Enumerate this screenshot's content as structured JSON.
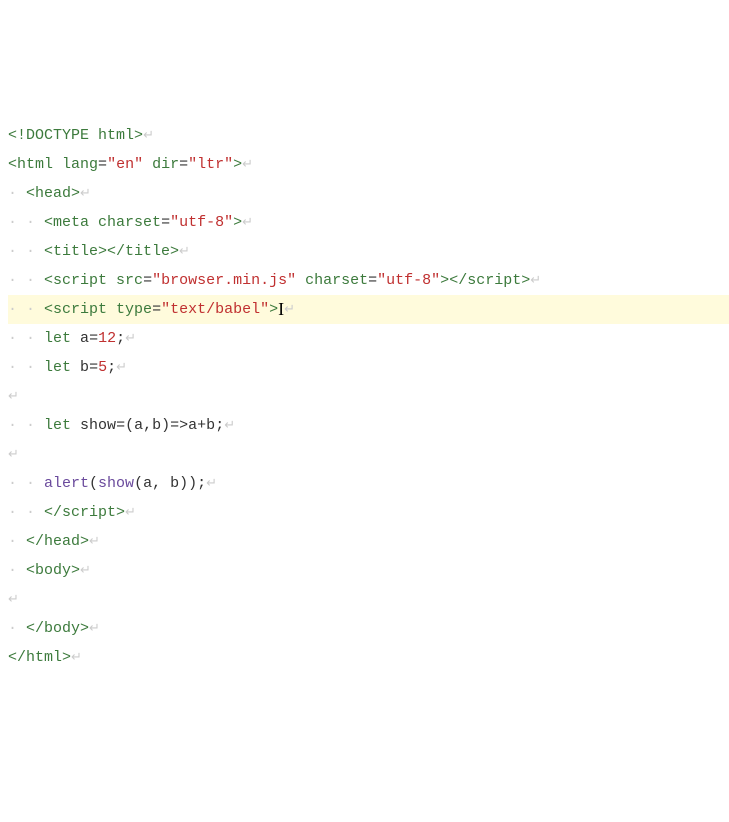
{
  "editor": {
    "highlighted_line_index": 6,
    "cursor_line_index": 6,
    "lines": [
      {
        "indent": 0,
        "tokens": [
          {
            "t": "tag",
            "v": "<!DOCTYPE"
          },
          {
            "t": "plain",
            "v": " "
          },
          {
            "t": "attr-name",
            "v": "html"
          },
          {
            "t": "tag",
            "v": ">"
          },
          {
            "t": "ws",
            "v": "↵"
          }
        ]
      },
      {
        "indent": 0,
        "tokens": [
          {
            "t": "tag",
            "v": "<html"
          },
          {
            "t": "plain",
            "v": " "
          },
          {
            "t": "attr-name",
            "v": "lang"
          },
          {
            "t": "punct",
            "v": "="
          },
          {
            "t": "attr-val",
            "v": "\"en\""
          },
          {
            "t": "plain",
            "v": " "
          },
          {
            "t": "attr-name",
            "v": "dir"
          },
          {
            "t": "punct",
            "v": "="
          },
          {
            "t": "attr-val",
            "v": "\"ltr\""
          },
          {
            "t": "tag",
            "v": ">"
          },
          {
            "t": "ws",
            "v": "↵"
          }
        ]
      },
      {
        "indent": 1,
        "tokens": [
          {
            "t": "tag",
            "v": "<head>"
          },
          {
            "t": "ws",
            "v": "↵"
          }
        ]
      },
      {
        "indent": 2,
        "tokens": [
          {
            "t": "tag",
            "v": "<meta"
          },
          {
            "t": "plain",
            "v": " "
          },
          {
            "t": "attr-name",
            "v": "charset"
          },
          {
            "t": "punct",
            "v": "="
          },
          {
            "t": "attr-val",
            "v": "\"utf-8\""
          },
          {
            "t": "tag",
            "v": ">"
          },
          {
            "t": "ws",
            "v": "↵"
          }
        ]
      },
      {
        "indent": 2,
        "tokens": [
          {
            "t": "tag",
            "v": "<title></title>"
          },
          {
            "t": "ws",
            "v": "↵"
          }
        ]
      },
      {
        "indent": 2,
        "tokens": [
          {
            "t": "tag",
            "v": "<script"
          },
          {
            "t": "plain",
            "v": " "
          },
          {
            "t": "attr-name",
            "v": "src"
          },
          {
            "t": "punct",
            "v": "="
          },
          {
            "t": "attr-val",
            "v": "\"browser.min.js\""
          },
          {
            "t": "plain",
            "v": " "
          },
          {
            "t": "attr-name",
            "v": "charset"
          },
          {
            "t": "punct",
            "v": "="
          },
          {
            "t": "attr-val",
            "v": "\"utf-8\""
          },
          {
            "t": "tag",
            "v": ">"
          },
          {
            "t": "tag",
            "v": "</script>"
          },
          {
            "t": "ws",
            "v": "↵"
          }
        ]
      },
      {
        "indent": 2,
        "tokens": [
          {
            "t": "tag",
            "v": "<script"
          },
          {
            "t": "plain",
            "v": " "
          },
          {
            "t": "attr-name",
            "v": "type"
          },
          {
            "t": "punct",
            "v": "="
          },
          {
            "t": "attr-val",
            "v": "\"text/babel\""
          },
          {
            "t": "tag",
            "v": ">"
          },
          {
            "t": "cursor",
            "v": ""
          },
          {
            "t": "ws",
            "v": "↵"
          }
        ]
      },
      {
        "indent": 2,
        "tokens": [
          {
            "t": "keyword",
            "v": "let"
          },
          {
            "t": "plain",
            "v": " "
          },
          {
            "t": "ident",
            "v": "a"
          },
          {
            "t": "punct",
            "v": "="
          },
          {
            "t": "num",
            "v": "12"
          },
          {
            "t": "punct",
            "v": ";"
          },
          {
            "t": "ws",
            "v": "↵"
          }
        ]
      },
      {
        "indent": 2,
        "tokens": [
          {
            "t": "keyword",
            "v": "let"
          },
          {
            "t": "plain",
            "v": " "
          },
          {
            "t": "ident",
            "v": "b"
          },
          {
            "t": "punct",
            "v": "="
          },
          {
            "t": "num",
            "v": "5"
          },
          {
            "t": "punct",
            "v": ";"
          },
          {
            "t": "ws",
            "v": "↵"
          }
        ]
      },
      {
        "indent": 0,
        "tokens": [
          {
            "t": "ws",
            "v": "↵"
          }
        ]
      },
      {
        "indent": 2,
        "tokens": [
          {
            "t": "keyword",
            "v": "let"
          },
          {
            "t": "plain",
            "v": " "
          },
          {
            "t": "ident",
            "v": "show"
          },
          {
            "t": "punct",
            "v": "=("
          },
          {
            "t": "ident",
            "v": "a"
          },
          {
            "t": "punct",
            "v": ","
          },
          {
            "t": "ident",
            "v": "b"
          },
          {
            "t": "punct",
            "v": ")=>"
          },
          {
            "t": "ident",
            "v": "a"
          },
          {
            "t": "punct",
            "v": "+"
          },
          {
            "t": "ident",
            "v": "b"
          },
          {
            "t": "punct",
            "v": ";"
          },
          {
            "t": "ws",
            "v": "↵"
          }
        ]
      },
      {
        "indent": 0,
        "tokens": [
          {
            "t": "ws",
            "v": "↵"
          }
        ]
      },
      {
        "indent": 2,
        "tokens": [
          {
            "t": "func",
            "v": "alert"
          },
          {
            "t": "punct",
            "v": "("
          },
          {
            "t": "func",
            "v": "show"
          },
          {
            "t": "punct",
            "v": "("
          },
          {
            "t": "ident",
            "v": "a"
          },
          {
            "t": "punct",
            "v": ", "
          },
          {
            "t": "ident",
            "v": "b"
          },
          {
            "t": "punct",
            "v": "));"
          },
          {
            "t": "ws",
            "v": "↵"
          }
        ]
      },
      {
        "indent": 2,
        "tokens": [
          {
            "t": "tag",
            "v": "</script>"
          },
          {
            "t": "ws",
            "v": "↵"
          }
        ]
      },
      {
        "indent": 1,
        "tokens": [
          {
            "t": "tag",
            "v": "</head>"
          },
          {
            "t": "ws",
            "v": "↵"
          }
        ]
      },
      {
        "indent": 1,
        "tokens": [
          {
            "t": "tag",
            "v": "<body>"
          },
          {
            "t": "ws",
            "v": "↵"
          }
        ]
      },
      {
        "indent": 0,
        "tokens": [
          {
            "t": "ws",
            "v": "↵"
          }
        ]
      },
      {
        "indent": 1,
        "tokens": [
          {
            "t": "tag",
            "v": "</body>"
          },
          {
            "t": "ws",
            "v": "↵"
          }
        ]
      },
      {
        "indent": 0,
        "tokens": [
          {
            "t": "tag",
            "v": "</html>"
          },
          {
            "t": "ws",
            "v": "↵"
          }
        ]
      }
    ]
  }
}
